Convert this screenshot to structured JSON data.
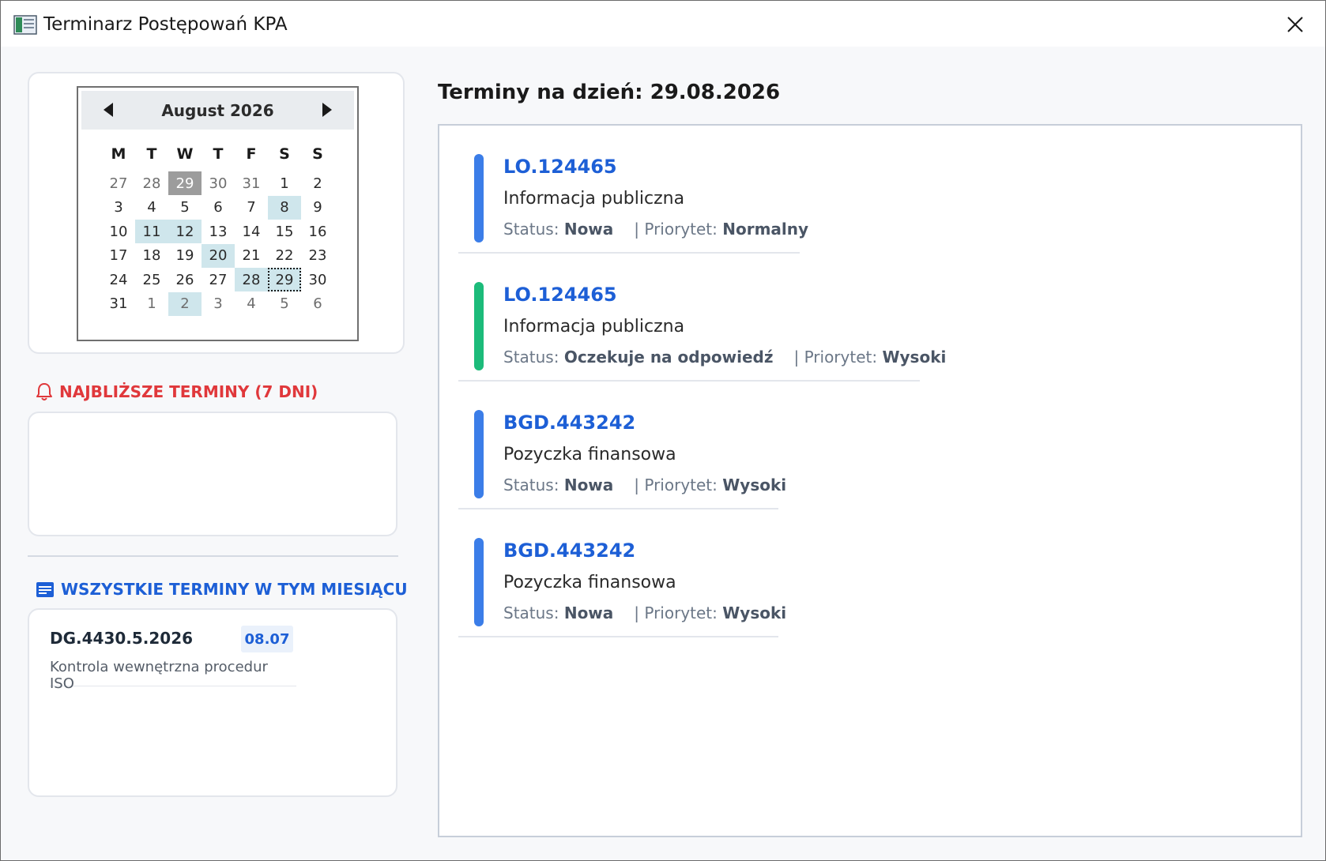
{
  "window": {
    "title": "Terminarz Postępowań KPA"
  },
  "calendar": {
    "month_label": "August 2026",
    "weekdays": [
      "M",
      "T",
      "W",
      "T",
      "F",
      "S",
      "S"
    ],
    "weeks": [
      [
        "27",
        "28",
        "29",
        "30",
        "31",
        "1",
        "2"
      ],
      [
        "3",
        "4",
        "5",
        "6",
        "7",
        "8",
        "9"
      ],
      [
        "10",
        "11",
        "12",
        "13",
        "14",
        "15",
        "16"
      ],
      [
        "17",
        "18",
        "19",
        "20",
        "21",
        "22",
        "23"
      ],
      [
        "24",
        "25",
        "26",
        "27",
        "28",
        "29",
        "30"
      ],
      [
        "31",
        "1",
        "2",
        "3",
        "4",
        "5",
        "6"
      ]
    ],
    "other_month": [
      [
        0,
        0
      ],
      [
        0,
        1
      ],
      [
        0,
        2
      ],
      [
        0,
        3
      ],
      [
        0,
        4
      ],
      [
        5,
        1
      ],
      [
        5,
        2
      ],
      [
        5,
        3
      ],
      [
        5,
        4
      ],
      [
        5,
        5
      ],
      [
        5,
        6
      ]
    ],
    "highlighted": [
      [
        1,
        5
      ],
      [
        2,
        1
      ],
      [
        2,
        2
      ],
      [
        3,
        3
      ],
      [
        4,
        4
      ],
      [
        5,
        2
      ]
    ],
    "today": [
      0,
      2
    ],
    "selected": [
      4,
      5
    ]
  },
  "upcoming": {
    "title": "NAJBLIŻSZE TERMINY (7 DNI)"
  },
  "month_section": {
    "title": "WSZYSTKIE TERMINY W TYM MIESIĄCU",
    "items": [
      {
        "case": "DG.4430.5.2026",
        "date": "08.07",
        "description": "Kontrola wewnętrzna procedur ISO"
      }
    ]
  },
  "day_panel": {
    "title": "Terminy na dzień: 29.08.2026",
    "status_label": "Status:",
    "priority_label": "| Priorytet:",
    "items": [
      {
        "case": "LO.124465",
        "type": "Informacja publiczna",
        "status": "Nowa",
        "priority": "Normalny",
        "color": "#3b7de8"
      },
      {
        "case": "LO.124465",
        "type": "Informacja publiczna",
        "status": "Oczekuje na odpowiedź",
        "priority": "Wysoki",
        "color": "#1cbb7a"
      },
      {
        "case": "BGD.443242",
        "type": "Pozyczka finansowa",
        "status": "Nowa",
        "priority": "Wysoki",
        "color": "#3b7de8"
      },
      {
        "case": "BGD.443242",
        "type": "Pozyczka finansowa",
        "status": "Nowa",
        "priority": "Wysoki",
        "color": "#3b7de8"
      }
    ]
  }
}
